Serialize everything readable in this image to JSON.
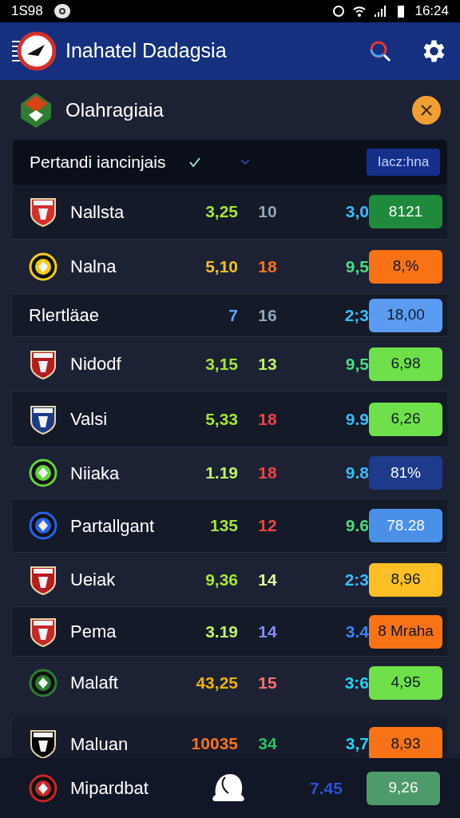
{
  "status_bar": {
    "left_text": "1S98",
    "time": "16:24"
  },
  "app_bar": {
    "title": "Inahatel Dadagsia"
  },
  "section": {
    "title": "Olahragiaia"
  },
  "table_header": {
    "label": "Pertandi iancinjais",
    "button": "Iacz:hna"
  },
  "rows": [
    {
      "kind": "team",
      "name": "Nallsta",
      "crest": {
        "kind": "shield",
        "color": "#d32f2f"
      },
      "values": [
        {
          "text": "3,25",
          "color": "#a3e635"
        },
        {
          "text": "10",
          "color": "#94a3b8"
        },
        {
          "text": "3,0",
          "color": "#38bdf8"
        }
      ],
      "badge": {
        "text": "8121",
        "color": "#1f8a3c"
      }
    },
    {
      "kind": "team",
      "name": "Nalna",
      "crest": {
        "kind": "circle",
        "color": "#facc15"
      },
      "values": [
        {
          "text": "5,10",
          "color": "#fbbf24"
        },
        {
          "text": "18",
          "color": "#f97316"
        },
        {
          "text": "9,5",
          "color": "#4ade80"
        }
      ],
      "badge": {
        "text": "8,%",
        "color": "#f97316"
      }
    },
    {
      "kind": "group",
      "name": "Rlertläae",
      "values": [
        {
          "text": "7",
          "color": "#60a5fa"
        },
        {
          "text": "16",
          "color": "#94a3b8"
        },
        {
          "text": "2;3",
          "color": "#38bdf8"
        }
      ],
      "badge": {
        "text": "18,00",
        "color": "#5b9cf0"
      }
    },
    {
      "kind": "team",
      "name": "Nidodf",
      "crest": {
        "kind": "shield",
        "color": "#b91c1c"
      },
      "values": [
        {
          "text": "3,15",
          "color": "#a3e635"
        },
        {
          "text": "13",
          "color": "#bef264"
        },
        {
          "text": "9,5",
          "color": "#4ade80"
        }
      ],
      "badge": {
        "text": "6,98",
        "color": "#6fe04a"
      }
    },
    {
      "kind": "team",
      "name": "Valsi",
      "crest": {
        "kind": "shield",
        "color": "#1e3a8a"
      },
      "values": [
        {
          "text": "5,33",
          "color": "#a3e635"
        },
        {
          "text": "18",
          "color": "#ef4444"
        },
        {
          "text": "9.9",
          "color": "#38bdf8"
        }
      ],
      "badge": {
        "text": "6,26",
        "color": "#6fe04a"
      }
    },
    {
      "kind": "team",
      "name": "Niiaka",
      "crest": {
        "kind": "circle",
        "color": "#65d13a"
      },
      "values": [
        {
          "text": "1.19",
          "color": "#bef264"
        },
        {
          "text": "18",
          "color": "#ef4444"
        },
        {
          "text": "9.8",
          "color": "#38bdf8"
        }
      ],
      "badge": {
        "text": "81%",
        "color": "#1e3a8a"
      }
    },
    {
      "kind": "team",
      "name": "Partallgant",
      "crest": {
        "kind": "circle",
        "color": "#2563eb"
      },
      "values": [
        {
          "text": "135",
          "color": "#a3e635"
        },
        {
          "text": "12",
          "color": "#ef4444"
        },
        {
          "text": "9.6",
          "color": "#4ade80"
        }
      ],
      "badge": {
        "text": "78.28",
        "color": "#4a90e8"
      }
    },
    {
      "kind": "team",
      "name": "Ueiak",
      "crest": {
        "kind": "shield",
        "color": "#b91c1c"
      },
      "values": [
        {
          "text": "9,36",
          "color": "#a3e635"
        },
        {
          "text": "14",
          "color": "#d9f99d"
        },
        {
          "text": "2:3",
          "color": "#38bdf8"
        }
      ],
      "badge": {
        "text": "8,96",
        "color": "#fbbf24"
      }
    },
    {
      "kind": "team",
      "name": "Pema",
      "crest": {
        "kind": "shield",
        "color": "#c62828"
      },
      "values": [
        {
          "text": "3.19",
          "color": "#bef264"
        },
        {
          "text": "14",
          "color": "#818cf8"
        },
        {
          "text": "3.4",
          "color": "#3b82f6"
        }
      ],
      "badge": {
        "text": "8 Mraha",
        "color": "#f97316"
      }
    },
    {
      "kind": "team",
      "name": "Malaft",
      "crest": {
        "kind": "circle",
        "color": "#2e7d32"
      },
      "values": [
        {
          "text": "43,25",
          "color": "#eab308"
        },
        {
          "text": "15",
          "color": "#f87171"
        },
        {
          "text": "3:6",
          "color": "#22d3ee"
        }
      ],
      "badge": {
        "text": "4,95",
        "color": "#6fe04a"
      }
    }
  ],
  "extra_row": {
    "kind": "team",
    "name": "Maluan",
    "crest": {
      "kind": "shield",
      "color": "#000000"
    },
    "values": [
      {
        "text": "10035",
        "color": "#f97316"
      },
      {
        "text": "34",
        "color": "#22c55e"
      },
      {
        "text": "3,7",
        "color": "#22d3ee"
      }
    ],
    "badge": {
      "text": "8,93",
      "color": "#f97316"
    }
  },
  "bottom_row": {
    "name": "Mipardbat",
    "crest": {
      "kind": "circle",
      "color": "#c62828"
    },
    "value": {
      "text": "7.45",
      "color": "#2f4fd6"
    },
    "badge": {
      "text": "9,26",
      "color": "#4f9a6a"
    }
  }
}
